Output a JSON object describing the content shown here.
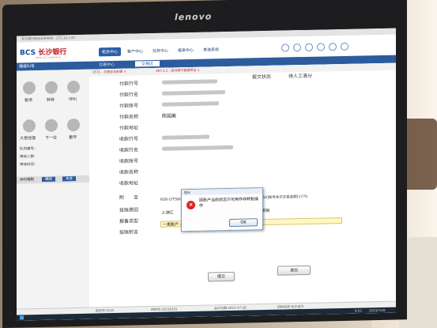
{
  "window": {
    "title": "长沙银行综合业务系统 - 172.16.2.67"
  },
  "monitor_brand": "lenovo",
  "bank": {
    "logo": "BCS",
    "name": "长沙银行",
    "subtitle": "BANK OF CHANGSHA"
  },
  "nav": {
    "items": [
      "柜员中心",
      "客户中心",
      "任务中心",
      "报表中心",
      "其他系统"
    ],
    "active": 0
  },
  "subnav": {
    "left": "播报叫号",
    "tabs": [
      "交易中心",
      "交易区"
    ],
    "active_tab": 1
  },
  "sidebar": {
    "controls": [
      {
        "icon": "pause-icon",
        "label": "暂停"
      },
      {
        "icon": "transfer-icon",
        "label": "转移"
      },
      {
        "icon": "recall-icon",
        "label": "呼叫"
      },
      {
        "icon": "lobby-manager-icon",
        "label": "大堂经理"
      },
      {
        "icon": "next-icon",
        "label": "下一位"
      },
      {
        "icon": "recall-again-icon",
        "label": "重呼"
      }
    ],
    "queue_lines": [
      "队列编号：",
      "等待人数：",
      "等待时间："
    ],
    "tabs": [
      "示行规则",
      "跟踪",
      "本金"
    ]
  },
  "doc_tabs": [
    "3571 - 交易业务处理 ×",
    "187.1.1 - 支付跨行普通贷记 ×"
  ],
  "form": {
    "labels": [
      "付款行号",
      "付款行名",
      "付款账号",
      "付款名称",
      "付款地址",
      "收款行号",
      "收款行名",
      "收款账号",
      "收款名称",
      "收款地址",
      "附　　言",
      "挂账原因",
      "报备类型",
      "挂账附言"
    ],
    "payer_name": "陈国美",
    "report_status_label": "报文状态",
    "report_status_value": "待人工清分",
    "memo": "RSB-LYTSBopt,B0479:[Bopt,B0479][6214467073316402458]账号本次交易金额[1770",
    "reason_label": "2-跨汇",
    "status_label": "状态撤销",
    "report_type": "一类账户 - 金额超限"
  },
  "buttons": {
    "submit": "提交",
    "exit": "退出"
  },
  "dialog": {
    "title": "提示",
    "message": "因账户当前状态只可用作非转账操作",
    "ok": "OK"
  },
  "statusbar": [
    "柜员号:9145",
    "机构号:20230101",
    "会计日期:2023-07-26",
    "机构名称:长沙支行"
  ],
  "taskbar": {
    "time": "9:52",
    "date": "2023/7/26"
  }
}
